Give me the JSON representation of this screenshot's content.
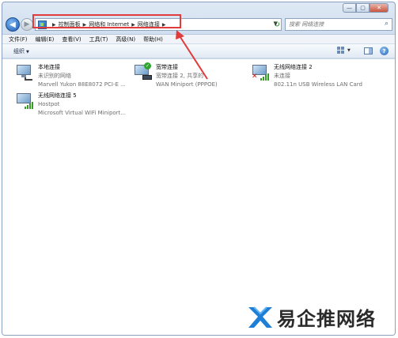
{
  "window": {
    "caption_buttons": [
      "—",
      "▢",
      "✕"
    ]
  },
  "nav": {
    "back_icon": "back-arrow-icon",
    "forward_icon": "forward-arrow-icon",
    "breadcrumbs": [
      "控制面板",
      "网络和 Internet",
      "网络连接"
    ],
    "refresh_glyph": "↻",
    "search_placeholder": "搜索 网络连接"
  },
  "menu": {
    "items": [
      "文件(F)",
      "编辑(E)",
      "查看(V)",
      "工具(T)",
      "高级(N)",
      "帮助(H)"
    ]
  },
  "command_bar": {
    "organize_label": "组织",
    "help_label": "?"
  },
  "connections": [
    {
      "name": "本地连接",
      "status": "未识别的网络",
      "device": "Marvell Yukon 88E8072 PCI-E ...",
      "icon": "wired-network-icon"
    },
    {
      "name": "宽带连接",
      "status": "宽带连接  2, 共享的",
      "device": "WAN Miniport (PPPOE)",
      "icon": "broadband-connected-icon"
    },
    {
      "name": "无线网络连接 2",
      "status": "未连接",
      "device": "802.11n USB Wireless LAN Card",
      "icon": "wireless-disconnected-icon"
    },
    {
      "name": "无线网络连接 5",
      "status": "Hostpot",
      "device": "Microsoft Virtual WiFi Miniport...",
      "icon": "wireless-connected-icon"
    }
  ],
  "colors": {
    "highlight": "#e23b3b",
    "signal": "#3a9a2a"
  },
  "watermark": {
    "text": "易企推网络"
  }
}
